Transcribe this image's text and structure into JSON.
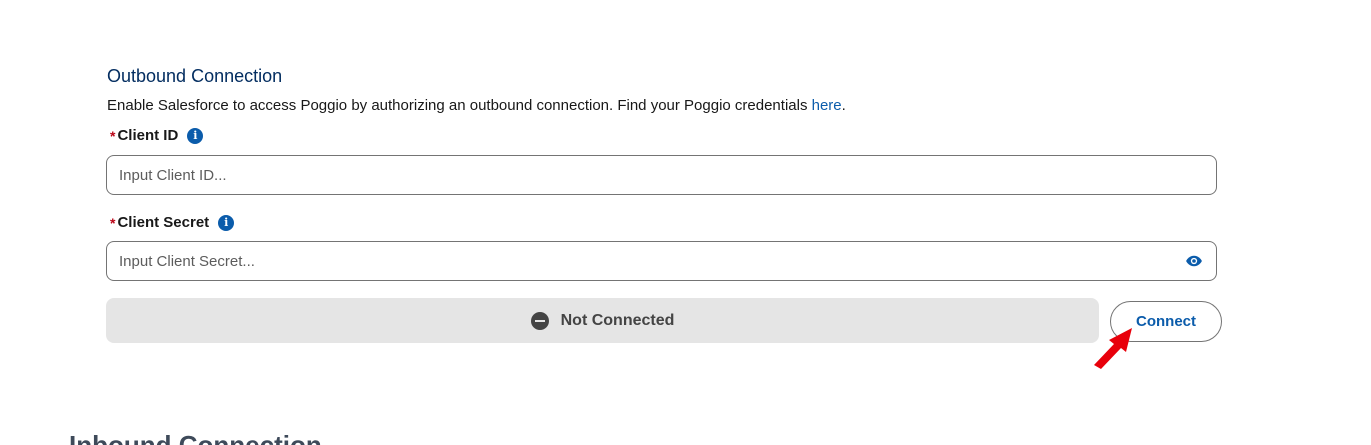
{
  "outbound": {
    "title": "Outbound Connection",
    "description_prefix": "Enable Salesforce to access Poggio by authorizing an outbound connection. Find your Poggio credentials ",
    "description_link": "here",
    "description_suffix": ".",
    "required_marker": "*",
    "info_glyph": "i",
    "client_id": {
      "label": "Client ID",
      "placeholder": "Input Client ID...",
      "value": ""
    },
    "client_secret": {
      "label": "Client Secret",
      "placeholder": "Input Client Secret...",
      "value": ""
    },
    "status": {
      "text": "Not Connected",
      "icon": "minus-circle-icon"
    },
    "connect_label": "Connect"
  },
  "inbound": {
    "title": "Inbound Connection"
  },
  "colors": {
    "accent": "#0b5cab",
    "required": "#ba0517",
    "status_bg": "#e5e5e5",
    "annotation_arrow": "#e8000b"
  }
}
